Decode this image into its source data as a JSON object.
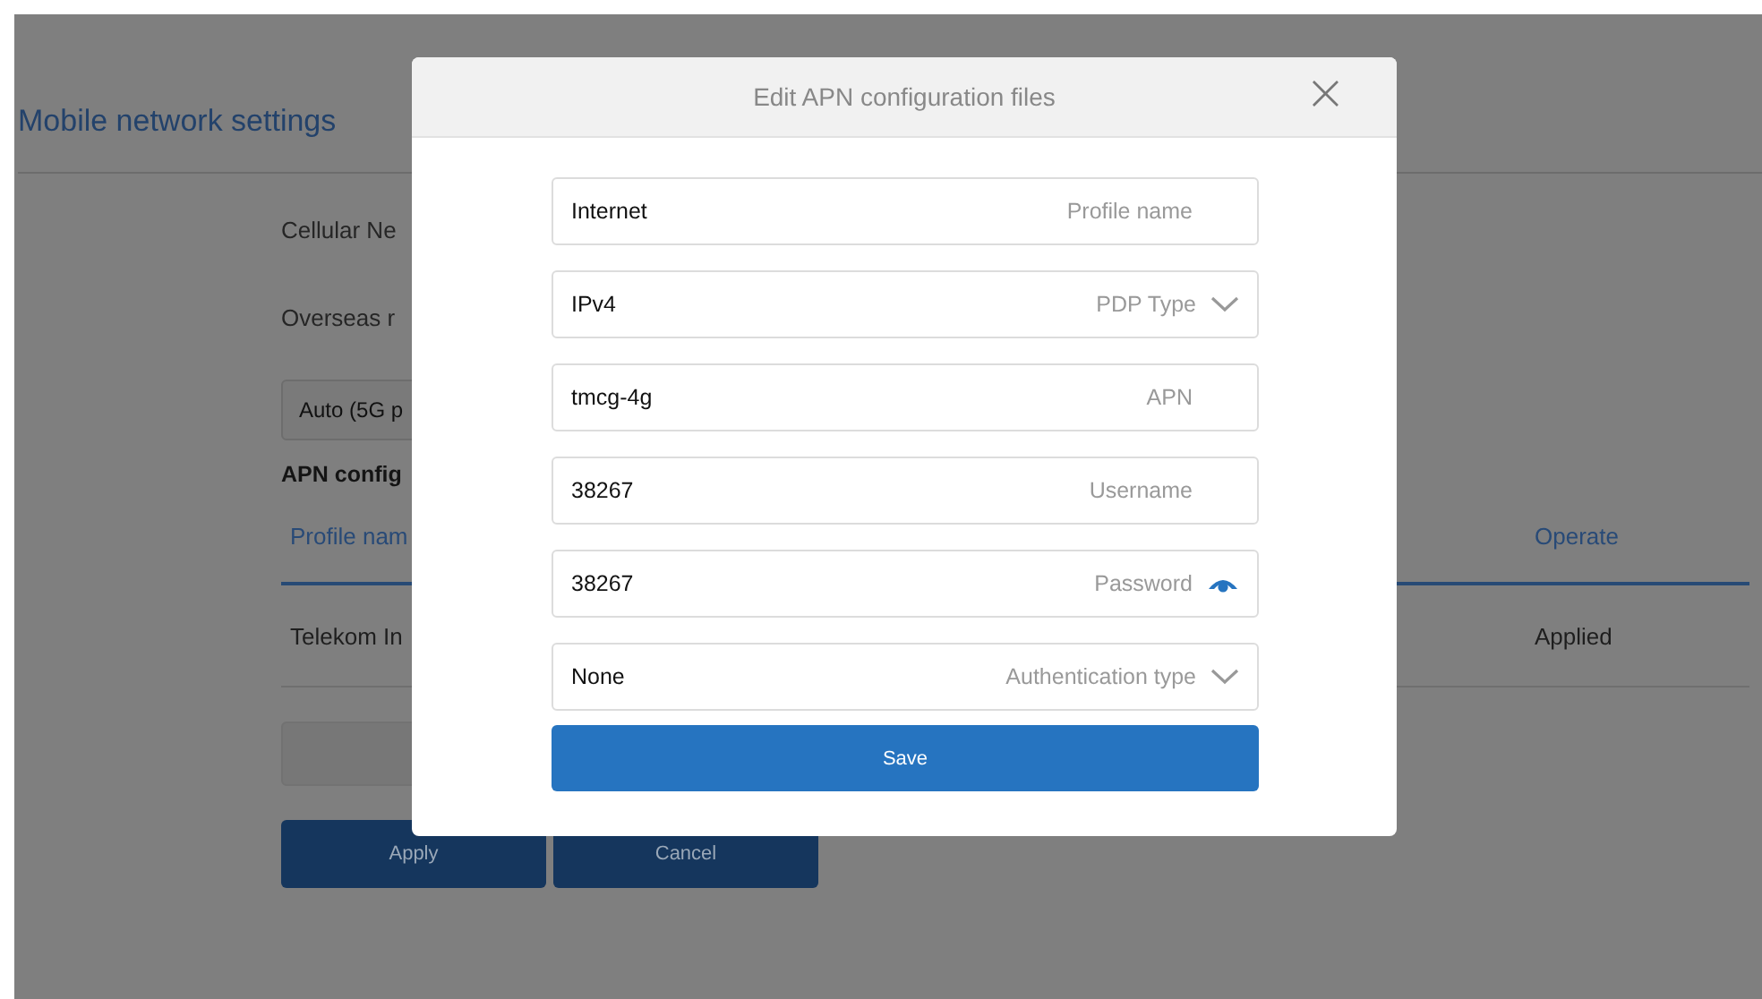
{
  "page": {
    "title": "Mobile network settings",
    "labels": [
      "Cellular Ne",
      "Overseas r"
    ],
    "network_select": {
      "value": "Auto (5G p"
    },
    "section_title": "APN config",
    "table": {
      "columns": [
        "Profile nam",
        "Operate"
      ],
      "rows": [
        [
          "Telekom In",
          "Applied"
        ]
      ]
    },
    "buttons": [
      "Apply",
      "Cancel"
    ]
  },
  "dialog": {
    "title": "Edit APN configuration files",
    "close": "×",
    "fields": [
      {
        "kind": "text",
        "value": "Internet",
        "label": "Profile name"
      },
      {
        "kind": "select",
        "value": "IPv4",
        "label": "PDP Type"
      },
      {
        "kind": "text",
        "value": "tmcg-4g",
        "label": "APN"
      },
      {
        "kind": "text",
        "value": "38267",
        "label": "Username"
      },
      {
        "kind": "password",
        "value": "38267",
        "label": "Password"
      },
      {
        "kind": "select",
        "value": "None",
        "label": "Authentication type"
      }
    ],
    "save": "Save"
  }
}
